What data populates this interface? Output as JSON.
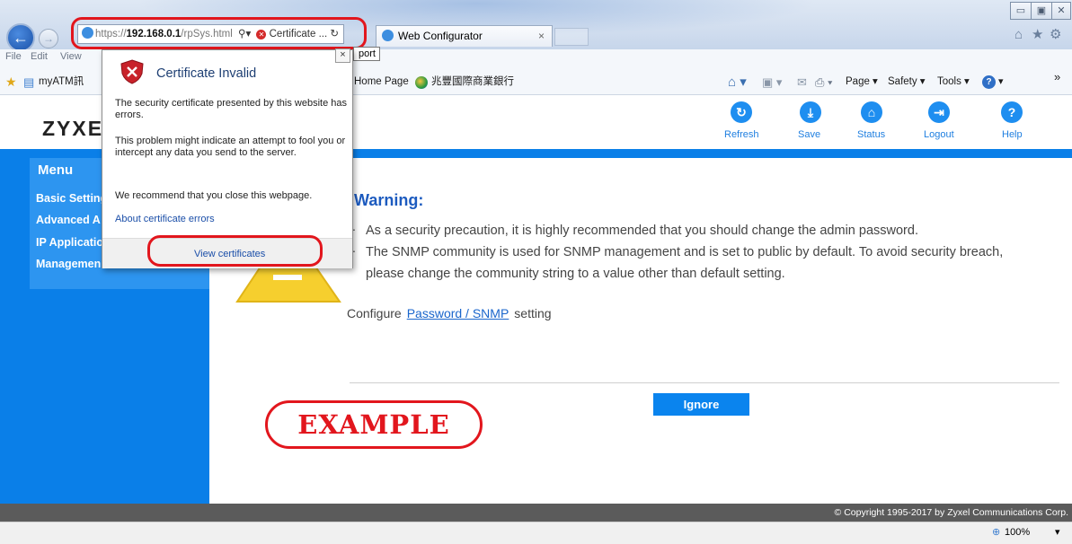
{
  "browser": {
    "address": {
      "scheme": "https://",
      "host": "192.168.0.1",
      "path": "/rpSys.html",
      "cert_label": "Certificate ..."
    },
    "tab_title": "Web Configurator",
    "menu": [
      "File",
      "Edit",
      "View"
    ],
    "favorites": {
      "first": "myATM訊",
      "home_page": "Home Page",
      "bank": "兆豐國際商業銀行"
    },
    "commands": {
      "page": "Page",
      "safety": "Safety",
      "tools": "Tools"
    },
    "tooltip": "port",
    "zoom": "100%",
    "chevron": "»"
  },
  "popup": {
    "title": "Certificate Invalid",
    "para1": "The security certificate presented by this website has errors.",
    "para2": "This problem might indicate an attempt to fool you or intercept any data you send to the server.",
    "para3": "We recommend that you close this webpage.",
    "link": "About certificate errors",
    "view_button": "View certificates",
    "close": "×"
  },
  "app": {
    "logo": "ZYXE",
    "header_buttons": [
      {
        "label": "Refresh",
        "icon": "refresh-icon"
      },
      {
        "label": "Save",
        "icon": "save-icon"
      },
      {
        "label": "Status",
        "icon": "status-icon"
      },
      {
        "label": "Logout",
        "icon": "logout-icon"
      },
      {
        "label": "Help",
        "icon": "help-icon"
      }
    ],
    "menu_title": "Menu",
    "menu_items": [
      "Basic Setting",
      "Advanced A",
      "IP Applicatio",
      "Managemen"
    ],
    "warning_title": "Warning:",
    "warning_lines": [
      "As a security precaution, it is highly recommended that you should change the admin password.",
      "The SNMP community is used for SNMP management and is set to public by default. To avoid security breach,",
      "please change the community string to a value other than default setting."
    ],
    "configure_prefix": "Configure",
    "configure_link": "Password / SNMP",
    "configure_suffix": "setting",
    "ignore_button": "Ignore",
    "footer": "© Copyright 1995-2017 by Zyxel Communications Corp."
  },
  "annotation": {
    "badge": "EXAMPLE"
  },
  "colors": {
    "accent": "#0a7fe8",
    "highlight": "#e2161d",
    "link": "#1a66cc"
  }
}
